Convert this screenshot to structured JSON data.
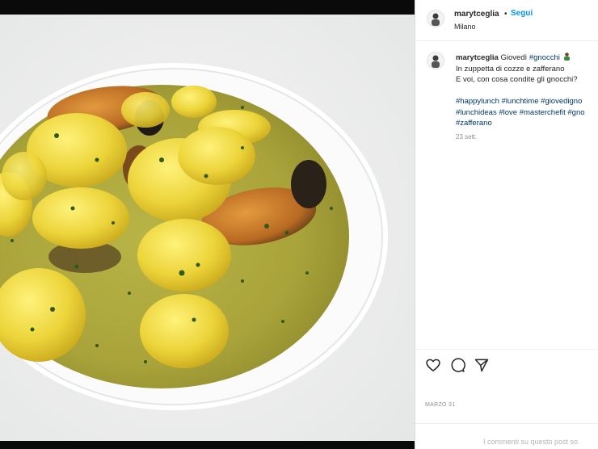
{
  "post": {
    "username": "marytceglia",
    "separator": "•",
    "follow_label": "Segui",
    "location": "Milano",
    "caption": {
      "username": "marytceglia",
      "line1_text": "Giovedì ",
      "line1_tag": "#gnocchi",
      "line2": "In zuppetta di cozze e zafferano",
      "line3": "E voi, con cosa condite gli gnocchi?",
      "tags_line1": [
        "#happylunch",
        "#lunchtime",
        "#giovedigno"
      ],
      "tags_line2": [
        "#lunchideas",
        "#love",
        "#masterchefit",
        "#gno"
      ],
      "tags_line3": [
        "#zafferano"
      ]
    },
    "time_ago": "23 sett.",
    "date": "MARZO 31",
    "comment_placeholder": "I commenti su questo post so"
  },
  "icons": {
    "like": "heart-icon",
    "comment": "comment-icon",
    "share": "paper-plane-icon",
    "emoji": "person-emoji-icon"
  },
  "colors": {
    "link_blue": "#0095f6",
    "hashtag": "#00376b",
    "text": "#262626",
    "muted": "#8e8e8e"
  }
}
